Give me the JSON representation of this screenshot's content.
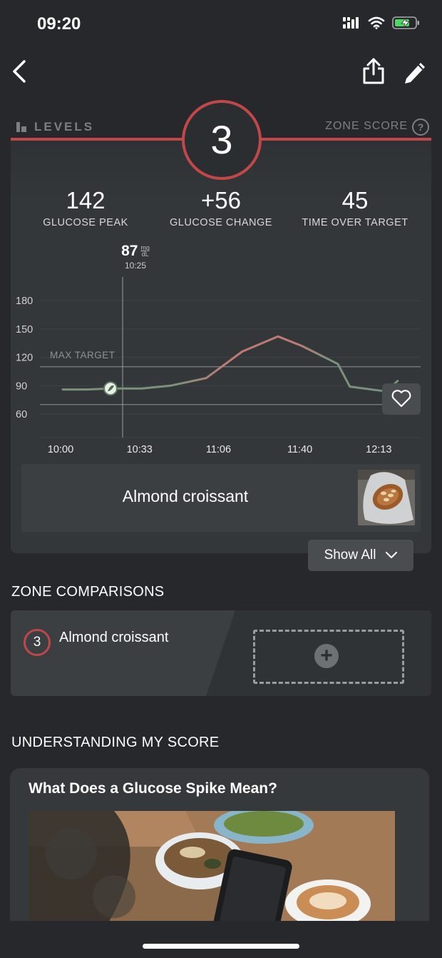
{
  "status_bar": {
    "time": "09:20",
    "icons": [
      "cellular-icon",
      "wifi-icon",
      "battery-charging-icon"
    ]
  },
  "nav": {
    "back_icon": "chevron-left-icon",
    "share_icon": "share-icon",
    "edit_icon": "pencil-icon"
  },
  "header": {
    "brand": "LEVELS",
    "zone_score_label": "ZONE SCORE",
    "zone_score": "3"
  },
  "stats": [
    {
      "value": "142",
      "label": "GLUCOSE PEAK"
    },
    {
      "value": "+56",
      "label": "GLUCOSE CHANGE"
    },
    {
      "value": "45",
      "label": "TIME OVER TARGET"
    }
  ],
  "readout": {
    "value": "87",
    "unit_top": "mg",
    "unit_bottom": "dL",
    "time": "10:25"
  },
  "chart_data": {
    "type": "line",
    "y_ticks": [
      "180",
      "150",
      "120",
      "90",
      "60"
    ],
    "x_ticks": [
      "10:00",
      "10:33",
      "11:06",
      "11:40",
      "12:13"
    ],
    "ylim": [
      45,
      180
    ],
    "max_target_label": "MAX TARGET",
    "max_target": 110,
    "min_target": 70,
    "x_minutes": [
      0,
      10,
      20,
      33,
      45,
      60,
      75,
      90,
      100,
      115,
      120,
      135,
      140
    ],
    "y": [
      86,
      86,
      87,
      87,
      90,
      98,
      126,
      142,
      132,
      113,
      89,
      84,
      95
    ],
    "colors": {
      "normal": "#7c917c",
      "high": "#c07a76"
    }
  },
  "meal": {
    "name": "Almond croissant",
    "heart_icon": "heart-icon"
  },
  "show_all": {
    "label": "Show All",
    "icon": "chevron-down-icon"
  },
  "zone_comparisons": {
    "title": "ZONE COMPARISONS",
    "items": [
      {
        "score": "3",
        "name": "Almond croissant"
      }
    ],
    "add_icon": "plus-icon"
  },
  "understanding": {
    "title": "UNDERSTANDING MY SCORE",
    "article_title": "What Does a Glucose Spike Mean?"
  }
}
